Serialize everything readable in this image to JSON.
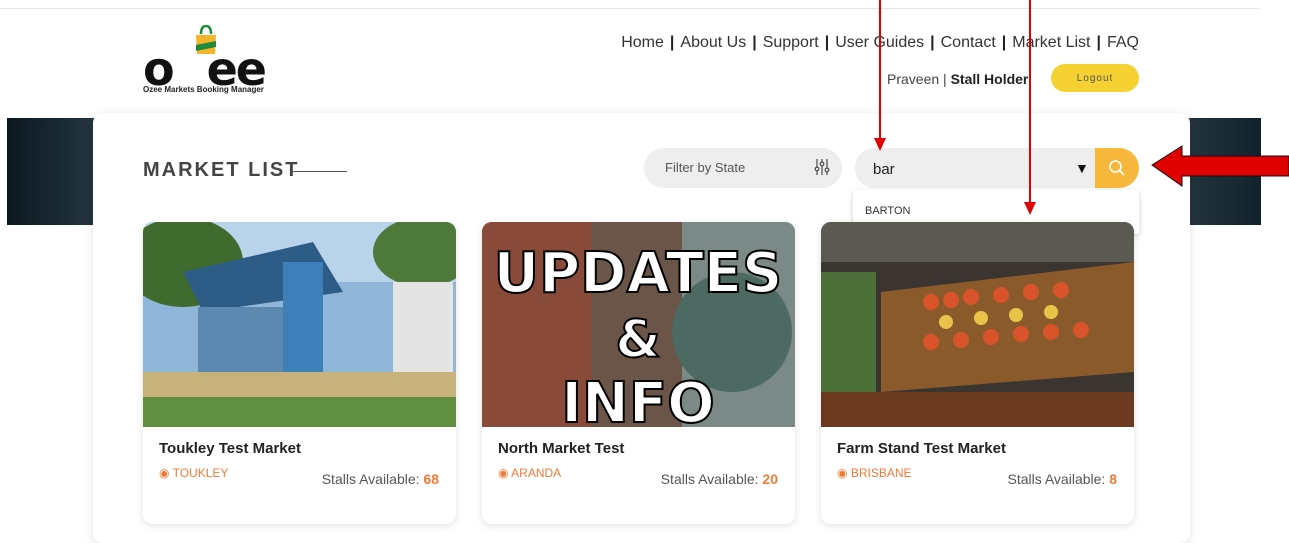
{
  "logo": {
    "text_o": "o",
    "text_ee": "ee",
    "tagline": "Ozee Markets Booking Manager"
  },
  "nav": {
    "items": [
      "Home",
      "About Us",
      "Support",
      "User Guides",
      "Contact",
      "Market List",
      "FAQ"
    ],
    "separator": "|"
  },
  "user": {
    "name": "Praveen",
    "separator": "|",
    "role": "Stall Holder",
    "logout_label": "Logout"
  },
  "page": {
    "title": "MARKET LIST"
  },
  "filter": {
    "label": "Filter by State",
    "icon": "sliders-icon"
  },
  "search": {
    "value": "bar",
    "dropdown_icon": "triangle-down-icon",
    "button_icon": "search-icon",
    "suggestions": [
      "BARTON"
    ]
  },
  "markets": [
    {
      "name": "Toukley Test Market",
      "location": "TOUKLEY",
      "stalls_label": "Stalls Available:",
      "stalls": "68"
    },
    {
      "name": "North Market Test",
      "location": "ARANDA",
      "stalls_label": "Stalls Available:",
      "stalls": "20"
    },
    {
      "name": "Farm Stand Test Market",
      "location": "BRISBANE",
      "stalls_label": "Stalls Available:",
      "stalls": "8"
    }
  ],
  "card2_image_text": [
    "UPDATES",
    "&",
    "INFO"
  ],
  "colors": {
    "accent": "#f7b73b",
    "logout": "#f5d132",
    "location": "#f07a36",
    "annotation": "#e00000"
  }
}
